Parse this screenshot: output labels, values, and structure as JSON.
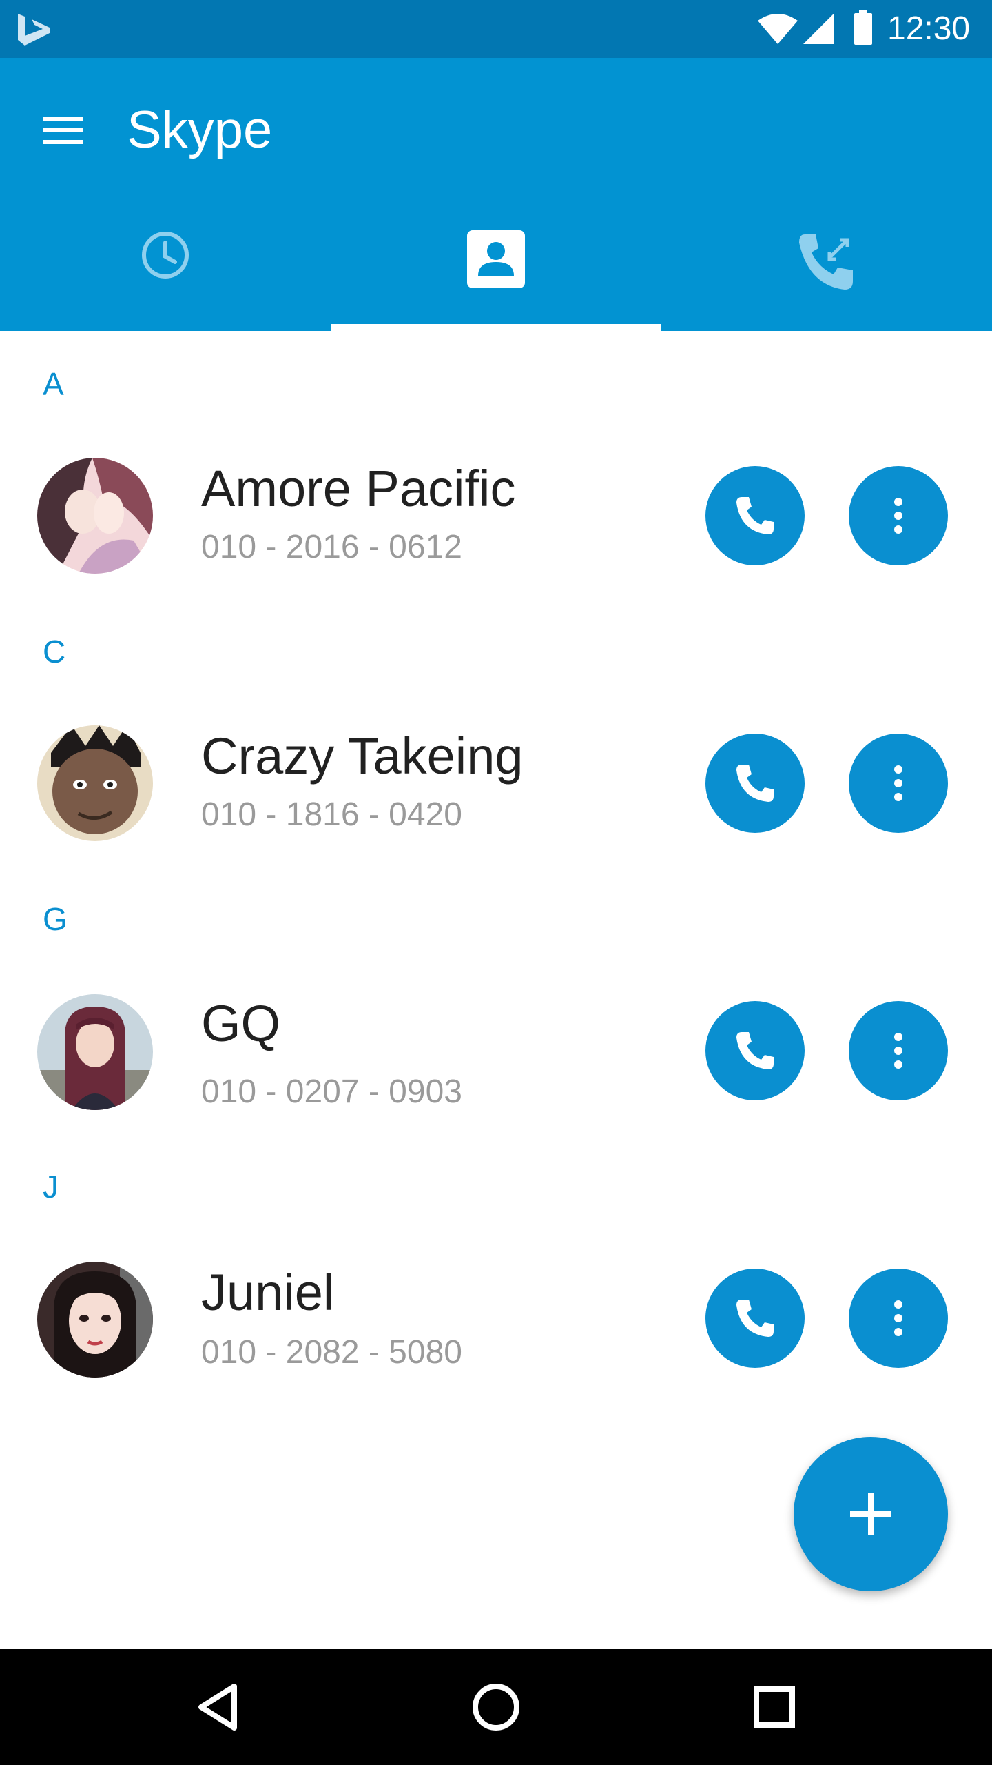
{
  "status_bar": {
    "time": "12:30",
    "icons": [
      "bing-logo-icon",
      "wifi-icon",
      "cell-signal-icon",
      "battery-icon"
    ]
  },
  "app_bar": {
    "title": "Skype",
    "menu_icon": "hamburger-menu-icon",
    "tabs": [
      {
        "icon": "clock-icon",
        "selected": false
      },
      {
        "icon": "contact-card-icon",
        "selected": true
      },
      {
        "icon": "phone-transfer-icon",
        "selected": false
      }
    ]
  },
  "contacts": {
    "sections": [
      {
        "letter": "A",
        "name": "Amore Pacific",
        "phone": "010 - 2016 - 0612"
      },
      {
        "letter": "C",
        "name": "Crazy Takeing",
        "phone": "010 - 1816 - 0420"
      },
      {
        "letter": "G",
        "name": "GQ",
        "phone": "010 - 0207 - 0903"
      },
      {
        "letter": "J",
        "name": "Juniel",
        "phone": "010 - 2082 - 5080"
      }
    ]
  },
  "fab": {
    "icon": "plus-icon"
  },
  "nav_bar": {
    "icons": [
      "back-triangle-icon",
      "home-circle-icon",
      "recents-square-icon"
    ]
  },
  "colors": {
    "status_bar": "#0277b2",
    "app_bar": "#0293d2",
    "accent": "#0a8fd0",
    "name_text": "#212121",
    "phone_text": "#9a9a9a"
  }
}
